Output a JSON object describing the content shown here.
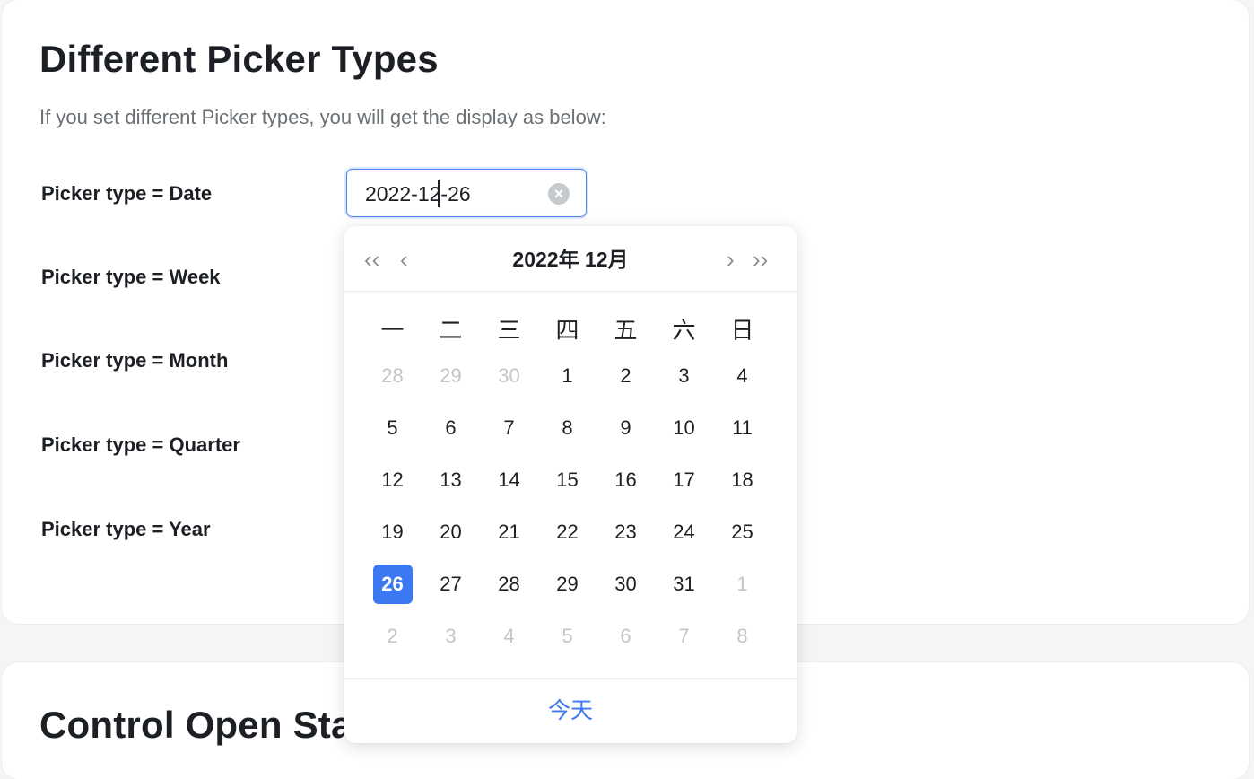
{
  "section1": {
    "title": "Different Picker Types",
    "description": "If you set different Picker types, you will get the display as below:",
    "labels": [
      "Picker type = Date",
      "Picker type = Week",
      "Picker type = Month",
      "Picker type = Quarter",
      "Picker type = Year"
    ]
  },
  "section2": {
    "title": "Control Open Sta"
  },
  "date_input": {
    "value": "2022-12-26",
    "clear_icon": "clear-circle-icon"
  },
  "calendar": {
    "nav": {
      "prev_year": "‹‹",
      "prev_month": "‹",
      "next_month": "›",
      "next_year": "››"
    },
    "header": "2022年  12月",
    "weekdays": [
      "一",
      "二",
      "三",
      "四",
      "五",
      "六",
      "日"
    ],
    "weeks": [
      [
        {
          "d": "28",
          "m": true
        },
        {
          "d": "29",
          "m": true
        },
        {
          "d": "30",
          "m": true
        },
        {
          "d": "1"
        },
        {
          "d": "2"
        },
        {
          "d": "3"
        },
        {
          "d": "4"
        }
      ],
      [
        {
          "d": "5"
        },
        {
          "d": "6"
        },
        {
          "d": "7"
        },
        {
          "d": "8"
        },
        {
          "d": "9"
        },
        {
          "d": "10"
        },
        {
          "d": "11"
        }
      ],
      [
        {
          "d": "12"
        },
        {
          "d": "13"
        },
        {
          "d": "14"
        },
        {
          "d": "15"
        },
        {
          "d": "16"
        },
        {
          "d": "17"
        },
        {
          "d": "18"
        }
      ],
      [
        {
          "d": "19"
        },
        {
          "d": "20"
        },
        {
          "d": "21"
        },
        {
          "d": "22"
        },
        {
          "d": "23"
        },
        {
          "d": "24"
        },
        {
          "d": "25"
        }
      ],
      [
        {
          "d": "26",
          "s": true
        },
        {
          "d": "27"
        },
        {
          "d": "28"
        },
        {
          "d": "29"
        },
        {
          "d": "30"
        },
        {
          "d": "31"
        },
        {
          "d": "1",
          "m": true
        }
      ],
      [
        {
          "d": "2",
          "m": true
        },
        {
          "d": "3",
          "m": true
        },
        {
          "d": "4",
          "m": true
        },
        {
          "d": "5",
          "m": true
        },
        {
          "d": "6",
          "m": true
        },
        {
          "d": "7",
          "m": true
        },
        {
          "d": "8",
          "m": true
        }
      ]
    ],
    "today_label": "今天",
    "colors": {
      "accent": "#3b78f2",
      "muted": "#c2c5c9"
    }
  }
}
